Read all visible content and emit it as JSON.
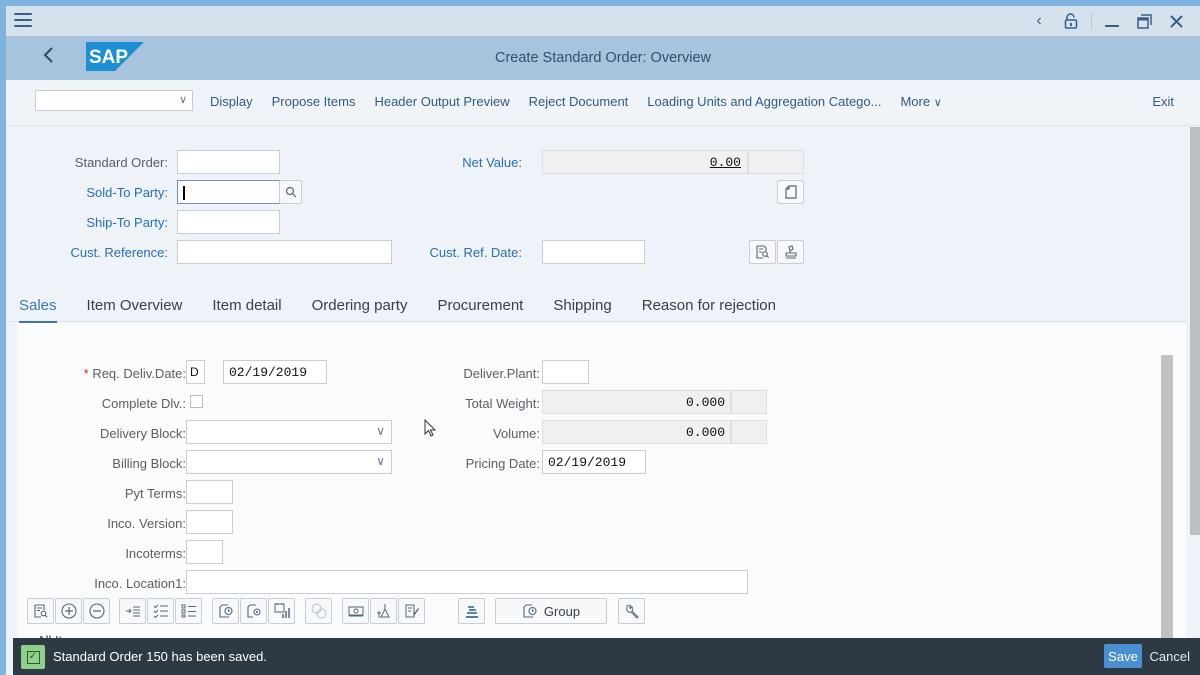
{
  "window": {
    "controls": [
      "back-icon",
      "unlock-icon",
      "minimize-icon",
      "restore-icon",
      "close-icon"
    ]
  },
  "shell": {
    "title": "Create Standard Order: Overview",
    "logo_text": "SAP"
  },
  "toolbar": {
    "select_value": "",
    "items": [
      "Display",
      "Propose Items",
      "Header Output Preview",
      "Reject Document",
      "Loading Units and Aggregation Catego...",
      "More"
    ],
    "more_chevron": "∨",
    "exit_label": "Exit"
  },
  "header": {
    "standard_order": {
      "label": "Standard Order:",
      "value": ""
    },
    "sold_to_party": {
      "label": "Sold-To Party:",
      "value": ""
    },
    "ship_to_party": {
      "label": "Ship-To Party:",
      "value": ""
    },
    "cust_reference": {
      "label": "Cust. Reference:",
      "value": ""
    },
    "net_value": {
      "label": "Net Value:",
      "value": "0.00",
      "currency": ""
    },
    "cust_ref_date": {
      "label": "Cust. Ref. Date:",
      "value": ""
    }
  },
  "tabs": [
    {
      "label": "Sales",
      "active": true
    },
    {
      "label": "Item Overview",
      "active": false
    },
    {
      "label": "Item detail",
      "active": false
    },
    {
      "label": "Ordering party",
      "active": false
    },
    {
      "label": "Procurement",
      "active": false
    },
    {
      "label": "Shipping",
      "active": false
    },
    {
      "label": "Reason for rejection",
      "active": false
    }
  ],
  "sales": {
    "req_deliv_date": {
      "label": "Req. Deliv.Date:",
      "required_mark": "*",
      "period": "D",
      "value": "02/19/2019"
    },
    "complete_dlv": {
      "label": "Complete Dlv.:",
      "checked": false
    },
    "delivery_block": {
      "label": "Delivery Block:",
      "value": ""
    },
    "billing_block": {
      "label": "Billing Block:",
      "value": ""
    },
    "pyt_terms": {
      "label": "Pyt Terms:",
      "value": ""
    },
    "inco_version": {
      "label": "Inco. Version:",
      "value": ""
    },
    "incoterms": {
      "label": "Incoterms:",
      "value": ""
    },
    "inco_location1": {
      "label": "Inco. Location1:",
      "value": ""
    },
    "deliver_plant": {
      "label": "Deliver.Plant:",
      "value": ""
    },
    "total_weight": {
      "label": "Total Weight:",
      "value": "0.000",
      "unit": ""
    },
    "volume": {
      "label": "Volume:",
      "value": "0.000",
      "unit": ""
    },
    "pricing_date": {
      "label": "Pricing Date:",
      "value": "02/19/2019"
    }
  },
  "item_toolbar": {
    "group_label": "Group",
    "all_items_label": "All Items"
  },
  "status": {
    "message": "Standard Order 150 has been saved.",
    "type": "success",
    "save_label": "Save",
    "cancel_label": "Cancel"
  },
  "colors": {
    "accent": "#3a78b5",
    "statusbar": "#2d3a44",
    "save_button": "#4a8fd1",
    "success": "#8ed28a"
  }
}
